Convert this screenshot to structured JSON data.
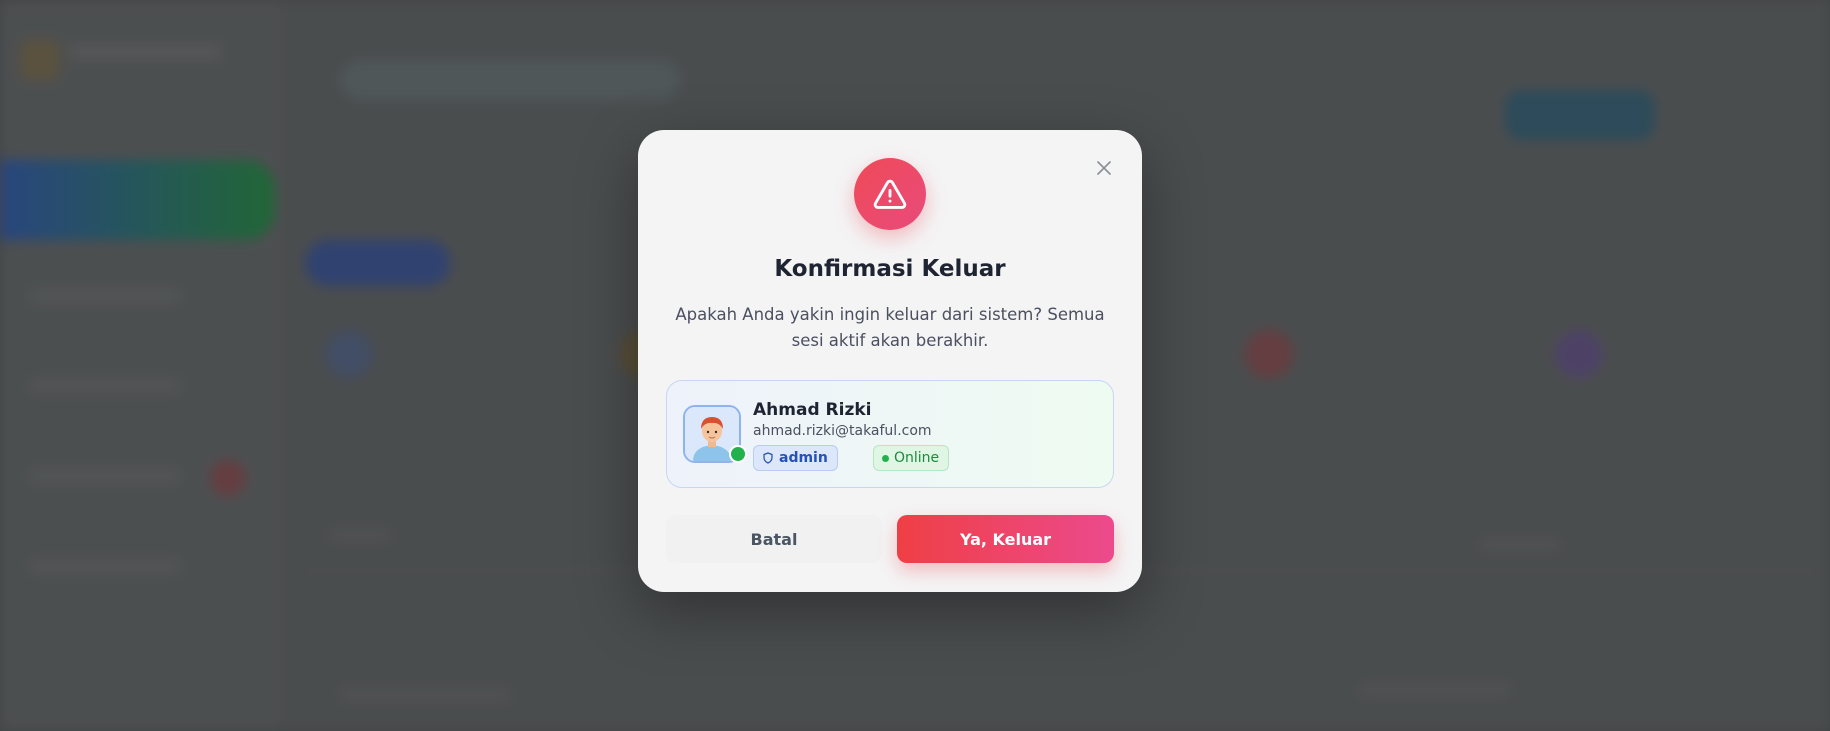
{
  "modal": {
    "title": "Konfirmasi Keluar",
    "description": "Apakah Anda yakin ingin keluar dari sistem? Semua sesi aktif akan berakhir.",
    "close_icon": "close-icon",
    "warning_icon": "warning-triangle-icon"
  },
  "user": {
    "name": "Ahmad Rizki",
    "email": "ahmad.rizki@takaful.com",
    "role": "admin",
    "status": "Online",
    "role_icon": "shield-icon",
    "avatar_icon": "user-avatar-icon"
  },
  "actions": {
    "cancel_label": "Batal",
    "confirm_label": "Ya, Keluar"
  },
  "colors": {
    "danger": "#ef4a57",
    "accent_pink": "#ec4a8d",
    "online": "#22b14c",
    "role_blue": "#2552b8",
    "modal_bg": "#f4f4f5"
  }
}
